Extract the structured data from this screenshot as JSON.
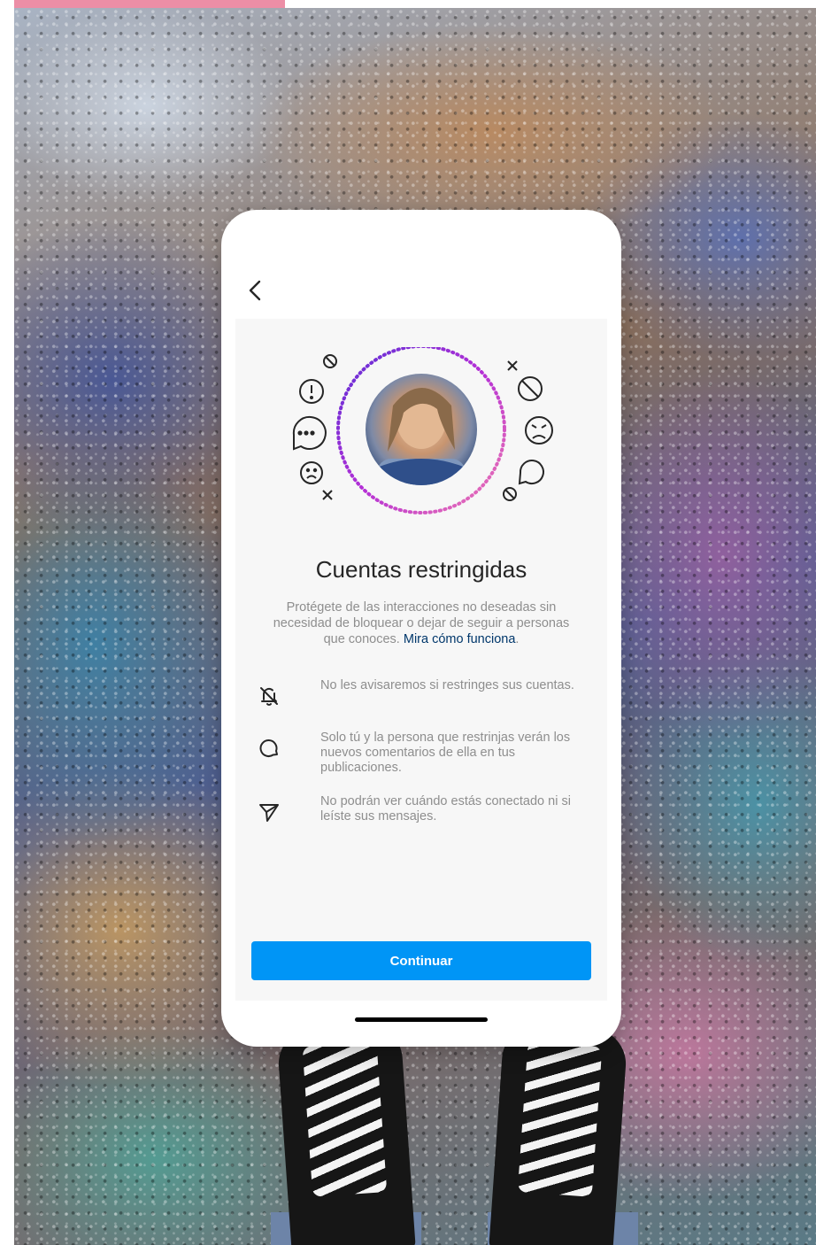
{
  "screen": {
    "title": "Cuentas restringidas",
    "description_text": "Protégete de las interacciones no deseadas sin necesidad de bloquear o dejar de seguir a personas que conoces. ",
    "description_link": "Mira cómo funciona",
    "description_end": ".",
    "features": [
      {
        "icon": "bell-slash-icon",
        "text": "No les avisaremos si restringes sus cuentas."
      },
      {
        "icon": "comment-bubble-icon",
        "text": "Solo tú y la persona que restrinjas verán los nuevos comentarios de ella en tus publicaciones."
      },
      {
        "icon": "direct-send-icon",
        "text": "No podrán ver cuándo estás conectado ni si leíste sus mensajes."
      }
    ],
    "continue_label": "Continuar"
  },
  "colors": {
    "accent": "#0095f6",
    "link": "#00376b",
    "pink_bar": "#ec8ea6"
  }
}
